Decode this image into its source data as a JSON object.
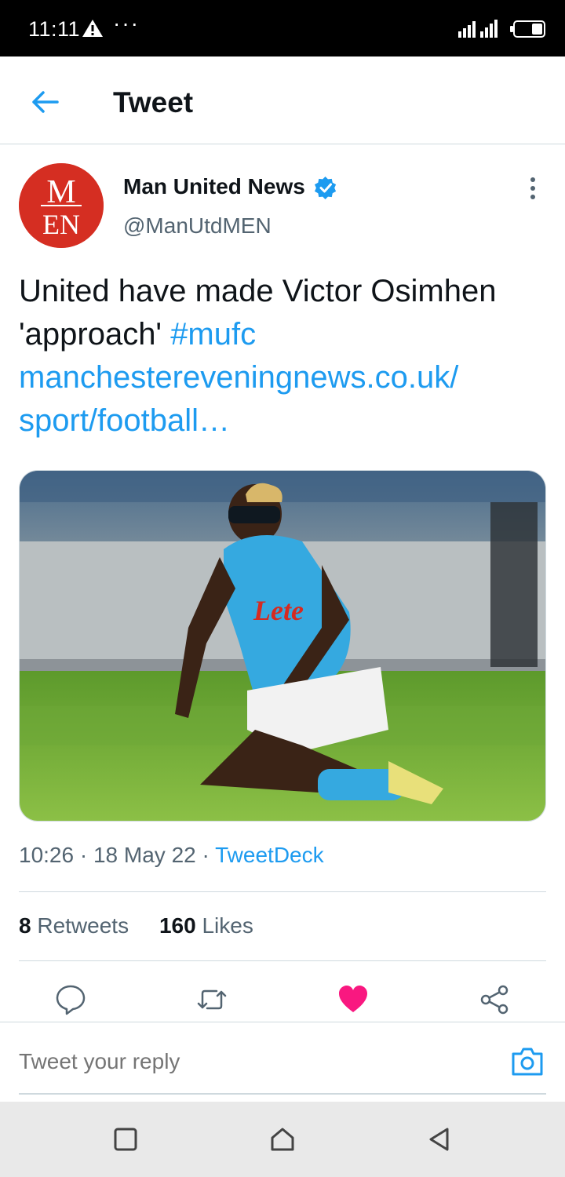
{
  "status_bar": {
    "time": "11:11",
    "dots": "···"
  },
  "header": {
    "title": "Tweet"
  },
  "tweet": {
    "author": {
      "name": "Man United News",
      "handle": "@ManUtdMEN",
      "avatar_text_top": "M",
      "avatar_text_bottom": "EN",
      "verified": true
    },
    "text_plain": "United have made Victor Osimhen 'approach' ",
    "hashtag": "#mufc",
    "link_line1": "manchestereveningnews.co.uk/",
    "link_line2": "sport/football…",
    "media_description_icon": "football-player-photo",
    "time": "10:26",
    "date": "18 May 22",
    "source": "TweetDeck",
    "retweets_count": "8",
    "retweets_label": "Retweets",
    "likes_count": "160",
    "likes_label": "Likes",
    "liked": true
  },
  "reply": {
    "placeholder": "Tweet your reply"
  },
  "colors": {
    "accent": "#1d9bf0",
    "like": "#f91880",
    "avatar_bg": "#d52e22"
  },
  "icons": {
    "back": "arrow-left-icon",
    "more": "more-vertical-icon",
    "reply": "comment-icon",
    "retweet": "retweet-icon",
    "like": "heart-icon",
    "share": "share-icon",
    "camera": "camera-icon"
  }
}
